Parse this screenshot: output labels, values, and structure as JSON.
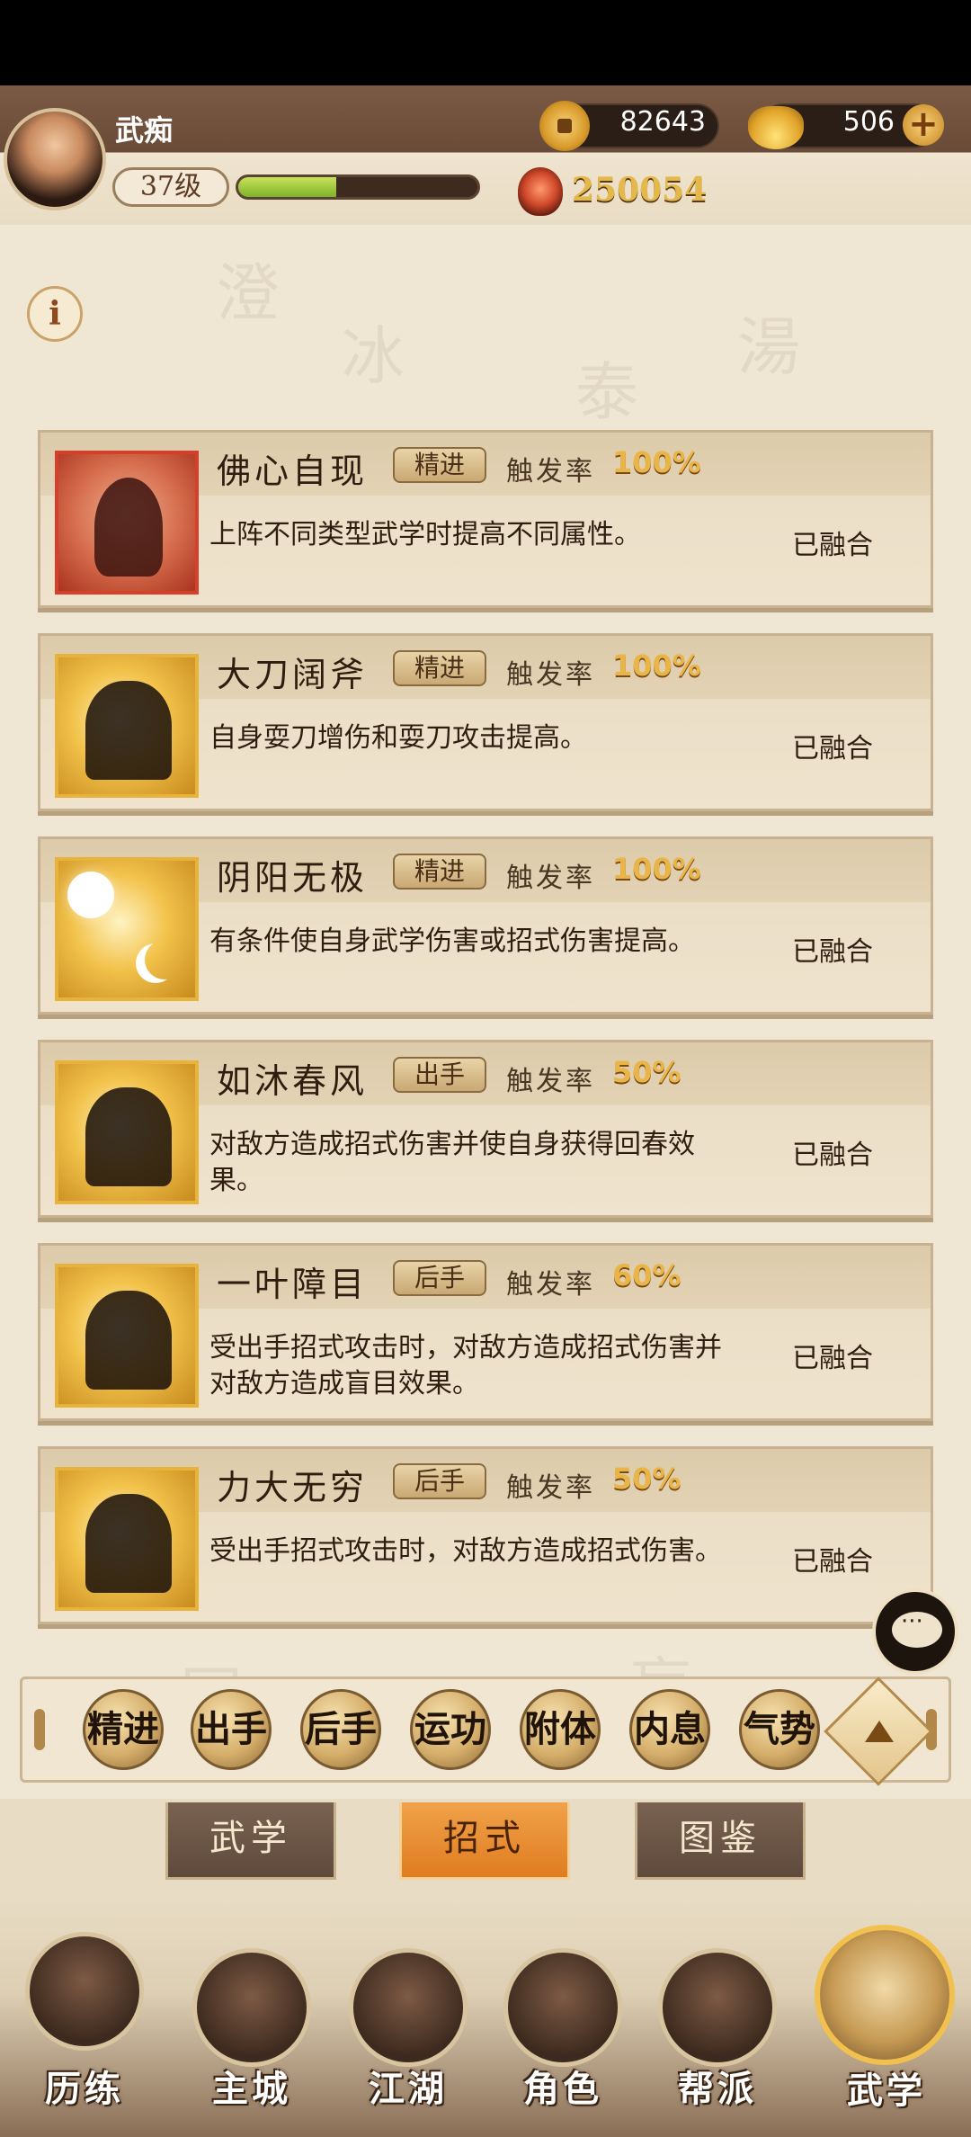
{
  "header": {
    "player_name": "武痴",
    "level": "37级",
    "exp_progress": 0.41,
    "power": "250054",
    "coins": "82643",
    "ingots": "506",
    "plus_symbol": "+"
  },
  "info_symbol": "i",
  "background_glyphs": [
    "澄",
    "冰",
    "泰",
    "湯",
    "同",
    "盲"
  ],
  "skills": [
    {
      "name": "佛心自现",
      "tag": "精进",
      "trigger_label": "触发率",
      "trigger_value": "100%",
      "description": "上阵不同类型武学时提高不同属性。",
      "status": "已融合",
      "icon": "praying-hands-icon",
      "frame_color": "red"
    },
    {
      "name": "大刀阔斧",
      "tag": "精进",
      "trigger_label": "触发率",
      "trigger_value": "100%",
      "description": "自身耍刀增伤和耍刀攻击提高。",
      "status": "已融合",
      "icon": "sword-warrior-icon",
      "frame_color": "gold"
    },
    {
      "name": "阴阳无极",
      "tag": "精进",
      "trigger_label": "触发率",
      "trigger_value": "100%",
      "description": "有条件使自身武学伤害或招式伤害提高。",
      "status": "已融合",
      "icon": "sun-moon-icon",
      "frame_color": "gold"
    },
    {
      "name": "如沐春风",
      "tag": "出手",
      "trigger_label": "触发率",
      "trigger_value": "50%",
      "description": "对敌方造成招式伤害并使自身获得回春效果。",
      "status": "已融合",
      "icon": "meditating-figure-icon",
      "frame_color": "gold"
    },
    {
      "name": "一叶障目",
      "tag": "后手",
      "trigger_label": "触发率",
      "trigger_value": "60%",
      "description": "受出手招式攻击时，对敌方造成招式伤害并对敌方造成盲目效果。",
      "status": "已融合",
      "icon": "blindfold-figure-icon",
      "frame_color": "gold"
    },
    {
      "name": "力大无穷",
      "tag": "后手",
      "trigger_label": "触发率",
      "trigger_value": "50%",
      "description": "受出手招式攻击时，对敌方造成招式伤害。",
      "status": "已融合",
      "icon": "strongman-icon",
      "frame_color": "gold"
    }
  ],
  "filters": [
    {
      "label": "精进"
    },
    {
      "label": "出手"
    },
    {
      "label": "后手"
    },
    {
      "label": "运功"
    },
    {
      "label": "附体"
    },
    {
      "label": "内息"
    },
    {
      "label": "气势"
    }
  ],
  "subtabs": [
    {
      "label": "武学",
      "active": false
    },
    {
      "label": "招式",
      "active": true
    },
    {
      "label": "图鉴",
      "active": false
    }
  ],
  "nav": [
    {
      "label": "历练",
      "icon": "scroll-sword-icon"
    },
    {
      "label": "主城",
      "icon": "palace-gate-icon"
    },
    {
      "label": "江湖",
      "icon": "sword-gourd-icon"
    },
    {
      "label": "角色",
      "icon": "straw-hat-hero-icon"
    },
    {
      "label": "帮派",
      "icon": "gang-emblem-icon"
    },
    {
      "label": "武学",
      "icon": "martial-scrolls-icon",
      "active": true
    }
  ],
  "colors": {
    "accent_gold": "#e9b548",
    "active_tab": "#e07c20",
    "exp_green": "#9fcb3a"
  }
}
